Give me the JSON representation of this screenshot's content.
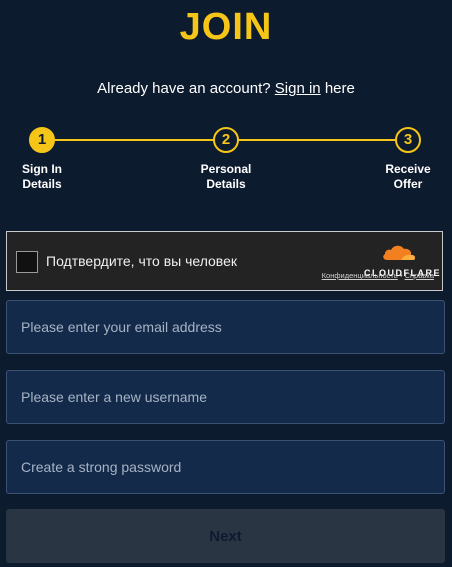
{
  "page": {
    "title": "JOIN"
  },
  "signin": {
    "prefix": "Already have an account?",
    "link": "Sign in",
    "suffix": "here"
  },
  "steps": [
    {
      "number": "1",
      "label_line1": "Sign In",
      "label_line2": "Details",
      "active": true
    },
    {
      "number": "2",
      "label_line1": "Personal",
      "label_line2": "Details",
      "active": false
    },
    {
      "number": "3",
      "label_line1": "Receive",
      "label_line2": "Offer",
      "active": false
    }
  ],
  "captcha": {
    "text": "Подтвердите, что вы человек",
    "brand": "CLOUDFLARE",
    "privacy_link": "Конфиденциальность",
    "separator": "•",
    "help_link": "Справка"
  },
  "form": {
    "email_placeholder": "Please enter your email address",
    "username_placeholder": "Please enter a new username",
    "password_placeholder": "Create a strong password",
    "next_label": "Next"
  },
  "colors": {
    "background": "#0d1b2e",
    "accent": "#f5c518",
    "field": "#142a4a",
    "button_disabled": "#2a3544"
  }
}
